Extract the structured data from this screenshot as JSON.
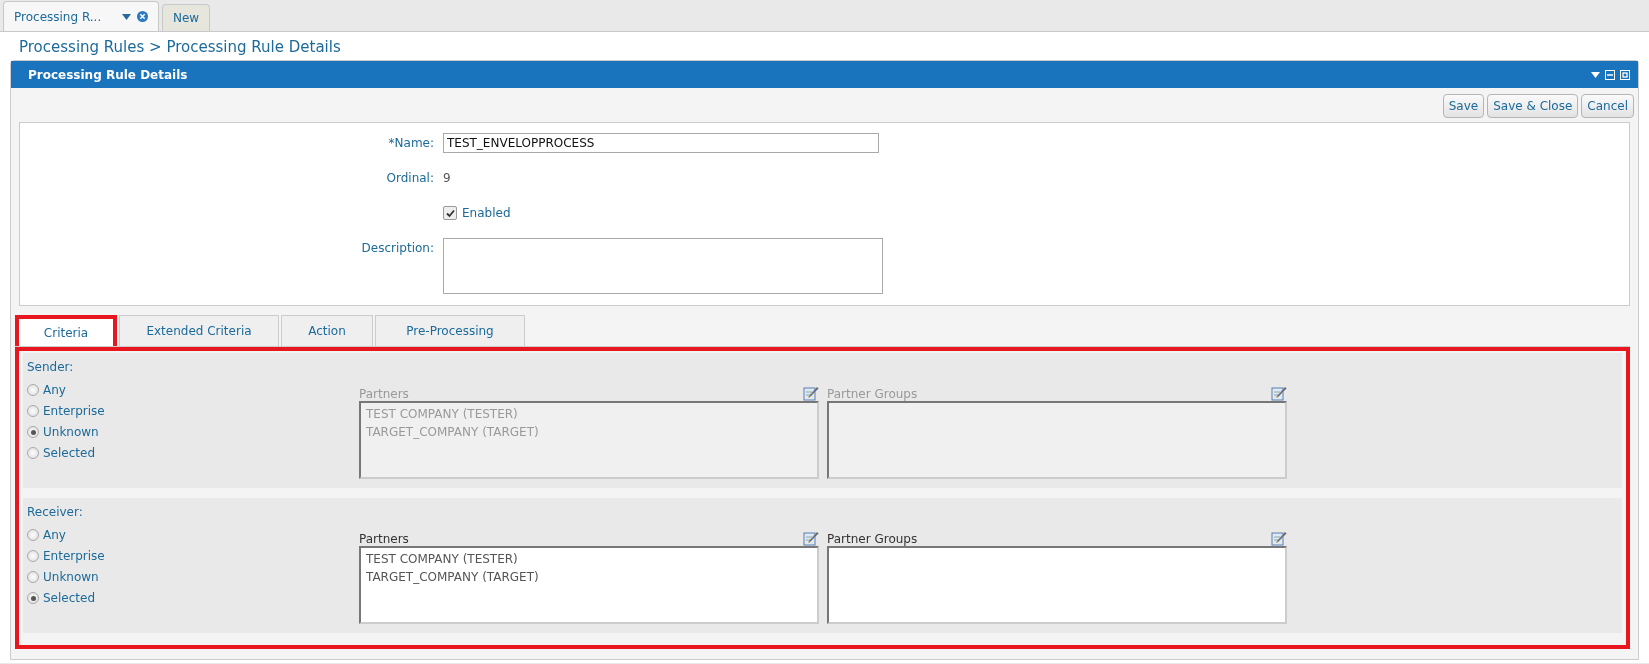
{
  "doc_tabs": [
    {
      "label": "Processing R...",
      "selected": true,
      "closable": true
    },
    {
      "label": "New",
      "selected": false,
      "closable": false
    }
  ],
  "breadcrumb": "Processing Rules > Processing Rule Details",
  "panel": {
    "title": "Processing Rule Details"
  },
  "buttons": [
    "Save",
    "Save & Close",
    "Cancel"
  ],
  "form": {
    "name_label": "*Name:",
    "name_value": "TEST_ENVELOPPROCESS",
    "ordinal_label": "Ordinal:",
    "ordinal_value": "9",
    "enabled": {
      "label": "Enabled",
      "checked": true
    },
    "description_label": "Description:"
  },
  "tabs": [
    {
      "label": "Criteria",
      "selected": true
    },
    {
      "label": "Extended Criteria",
      "selected": false
    },
    {
      "label": "Action",
      "selected": false
    },
    {
      "label": "Pre-Processing",
      "selected": false
    }
  ],
  "sections": [
    {
      "title": "Sender:",
      "disabled": true,
      "options": [
        {
          "label": "Any",
          "selected": false
        },
        {
          "label": "Enterprise",
          "selected": false
        },
        {
          "label": "Unknown",
          "selected": true
        },
        {
          "label": "Selected",
          "selected": false
        }
      ],
      "partners_label": "Partners",
      "partners": [
        "TEST COMPANY (TESTER)",
        "TARGET_COMPANY (TARGET)"
      ],
      "groups_label": "Partner Groups"
    },
    {
      "title": "Receiver:",
      "disabled": false,
      "options": [
        {
          "label": "Any",
          "selected": false
        },
        {
          "label": "Enterprise",
          "selected": false
        },
        {
          "label": "Unknown",
          "selected": false
        },
        {
          "label": "Selected",
          "selected": true
        }
      ],
      "partners_label": "Partners",
      "partners": [
        "TEST COMPANY (TESTER)",
        "TARGET_COMPANY (TARGET)"
      ],
      "groups_label": "Partner Groups"
    }
  ]
}
